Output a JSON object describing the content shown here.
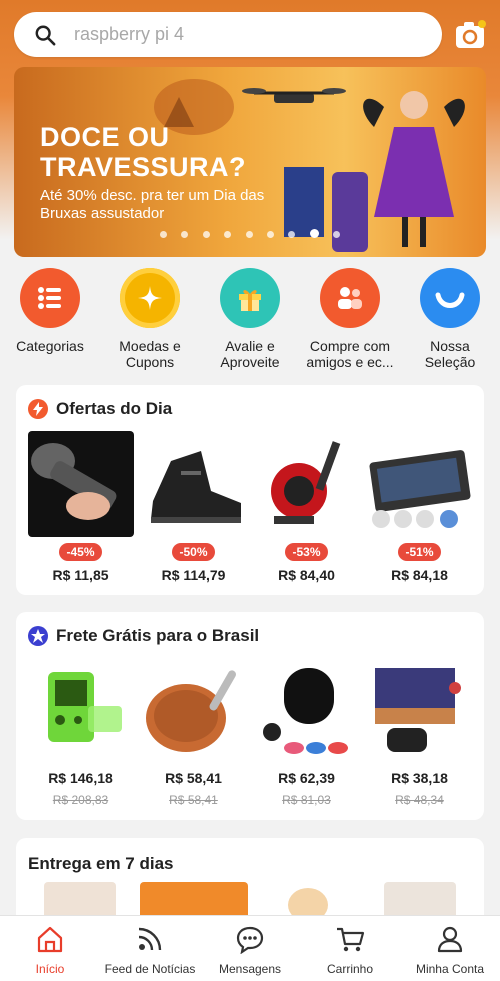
{
  "search": {
    "placeholder": "raspberry pi 4"
  },
  "banner": {
    "title": "DOCE OU TRAVESSURA?",
    "subtitle": "Até 30% desc. pra ter um Dia das Bruxas assustador"
  },
  "quick_links": [
    {
      "label": "Categorias",
      "icon": "list-icon",
      "color": "#f25a2e"
    },
    {
      "label": "Moedas e Cupons",
      "icon": "sparkle-icon",
      "color": "#f5b400"
    },
    {
      "label": "Avalie e Aproveite",
      "icon": "gift-icon",
      "color": "#2ec4b6"
    },
    {
      "label": "Compre com amigos e ec...",
      "icon": "friends-icon",
      "color": "#f25a2e"
    },
    {
      "label": "Nossa Seleção",
      "icon": "smile-icon",
      "color": "#2b8cf0"
    }
  ],
  "deals": {
    "title": "Ofertas do Dia",
    "items": [
      {
        "discount": "-45%",
        "price": "R$ 11,85",
        "image": "flashlight"
      },
      {
        "discount": "-50%",
        "price": "R$ 114,79",
        "image": "boots"
      },
      {
        "discount": "-53%",
        "price": "R$ 84,40",
        "image": "fishing-reel"
      },
      {
        "discount": "-51%",
        "price": "R$ 84,18",
        "image": "keyboard"
      }
    ]
  },
  "free_shipping": {
    "title": "Frete Grátis para o Brasil",
    "items": [
      {
        "price": "R$ 146,18",
        "old_price": "R$ 208,83",
        "image": "game-console"
      },
      {
        "price": "R$ 58,41",
        "old_price": "R$ 58,41",
        "image": "frying-pan"
      },
      {
        "price": "R$ 62,39",
        "old_price": "R$ 81,03",
        "image": "earbuds"
      },
      {
        "price": "R$ 38,18",
        "old_price": "R$ 48,34",
        "image": "retro-game"
      }
    ]
  },
  "delivery": {
    "title": "Entrega em 7 dias"
  },
  "tabbar": [
    {
      "label": "Início",
      "icon": "home-icon",
      "active": true
    },
    {
      "label": "Feed de Notícias",
      "icon": "feed-icon",
      "active": false
    },
    {
      "label": "Mensagens",
      "icon": "chat-icon",
      "active": false
    },
    {
      "label": "Carrinho",
      "icon": "cart-icon",
      "active": false
    },
    {
      "label": "Minha Conta",
      "icon": "user-icon",
      "active": false
    }
  ],
  "colors": {
    "accent": "#e83d2a",
    "badge": "#e84a3b",
    "banner": "#f0a63c"
  }
}
